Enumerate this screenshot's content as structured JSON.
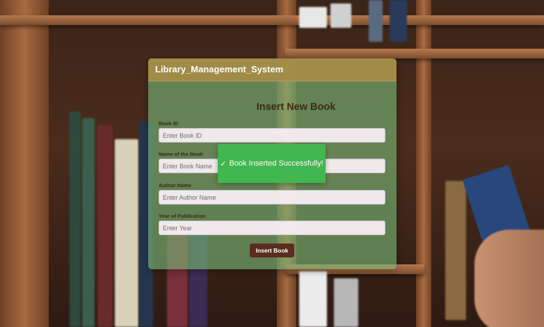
{
  "app": {
    "title": "Library_Management_System"
  },
  "form": {
    "title": "Insert New Book",
    "fields": [
      {
        "label": "Book ID",
        "placeholder": "Enter Book ID",
        "value": ""
      },
      {
        "label": "Name of the Book",
        "placeholder": "Enter Book Name",
        "value": ""
      },
      {
        "label": "Author Name",
        "placeholder": "Enter Author Name",
        "value": ""
      },
      {
        "label": "Year of Publication",
        "placeholder": "Enter Year",
        "value": ""
      }
    ],
    "submit_label": "Insert Book"
  },
  "toast": {
    "icon": "checkmark-icon",
    "icon_glyph": "✓",
    "message": "Book Inserted Successfully!"
  },
  "colors": {
    "header": "#a58c46",
    "card": "#78b978",
    "button": "#5b2d1e",
    "toast": "#42b64f"
  }
}
